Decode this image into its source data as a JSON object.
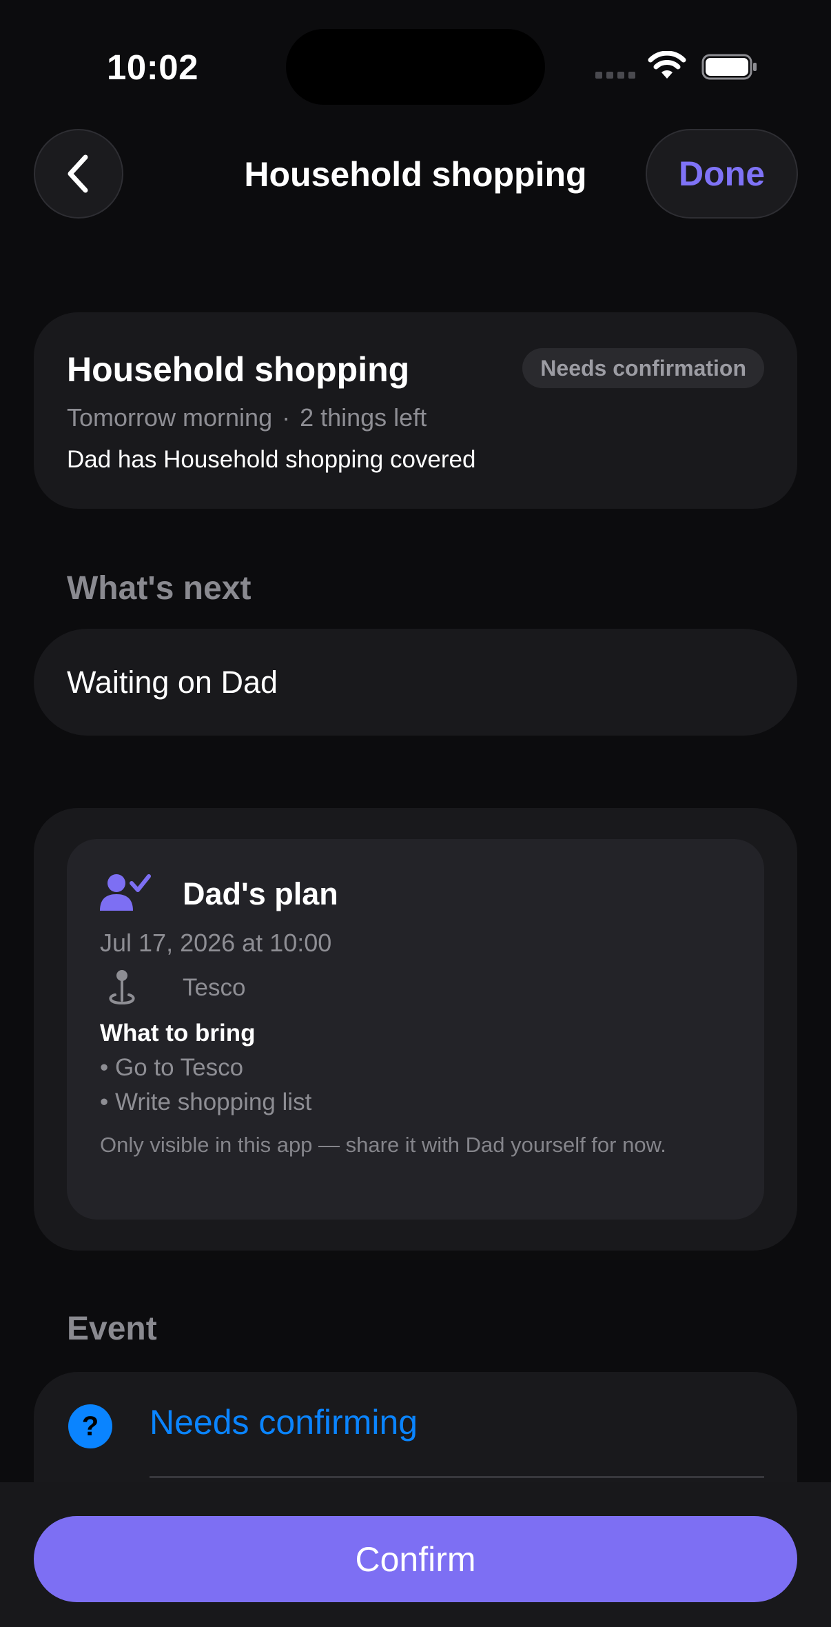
{
  "status_bar": {
    "time": "10:02"
  },
  "nav": {
    "title": "Household shopping",
    "done_label": "Done"
  },
  "summary": {
    "title": "Household shopping",
    "badge": "Needs confirmation",
    "when": "Tomorrow morning",
    "separator": "·",
    "remaining": "2 things left",
    "note": "Dad has Household shopping covered"
  },
  "whats_next": {
    "label": "What's next",
    "text": "Waiting on Dad"
  },
  "plan": {
    "title": "Dad's plan",
    "date": "Jul 17, 2026 at 10:00",
    "location": "Tesco",
    "bring_title": "What to bring",
    "bring_items": [
      "• Go to Tesco",
      "• Write shopping list"
    ],
    "footnote": "Only visible in this app — share it with Dad yourself for now."
  },
  "event": {
    "label": "Event",
    "status": "Needs confirming",
    "icon_glyph": "?"
  },
  "confirm_label": "Confirm",
  "colors": {
    "accent": "#7d6ff3",
    "link_blue": "#0a84ff",
    "background": "#0c0c0e"
  }
}
